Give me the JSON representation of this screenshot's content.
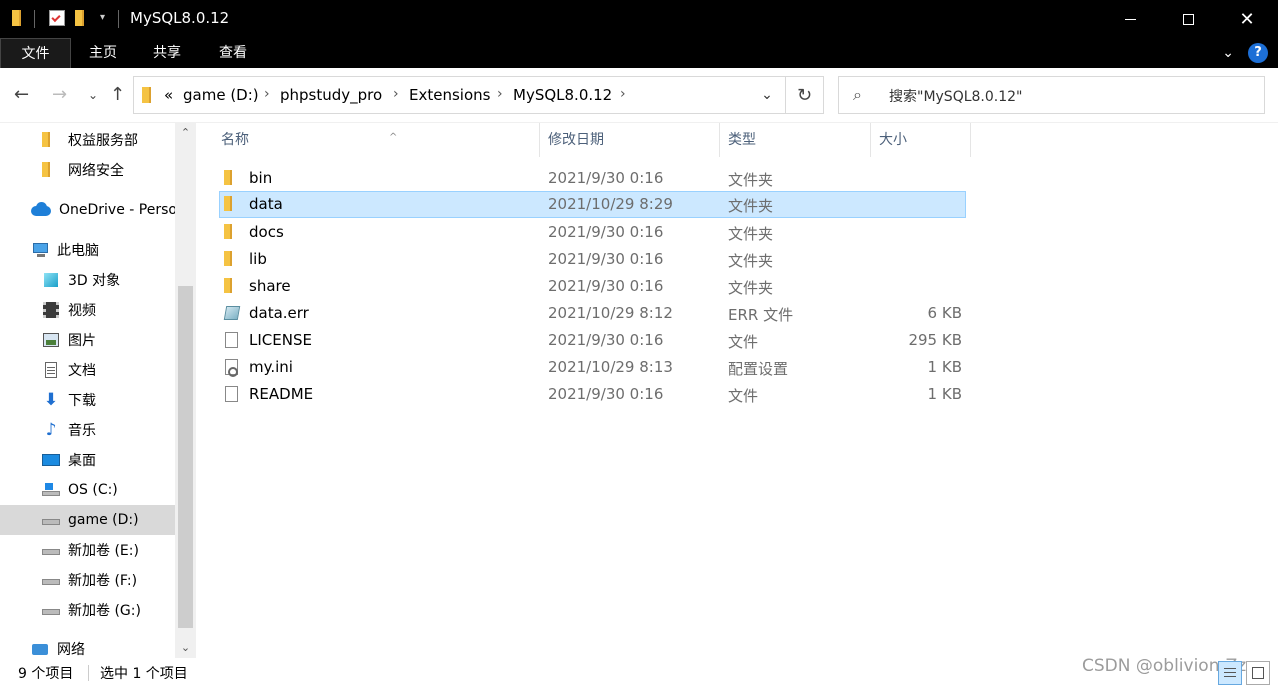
{
  "window": {
    "title": "MySQL8.0.12"
  },
  "ribbon": {
    "tabs": [
      "文件",
      "主页",
      "共享",
      "查看"
    ]
  },
  "address": {
    "overflow": "«",
    "crumbs": [
      "game (D:)",
      "phpstudy_pro",
      "Extensions",
      "MySQL8.0.12"
    ]
  },
  "search": {
    "placeholder": "搜索\"MySQL8.0.12\""
  },
  "sidebar": {
    "items": [
      {
        "label": "权益服务部",
        "icon": "folder-icon"
      },
      {
        "label": "网络安全",
        "icon": "folder-icon"
      },
      {
        "label": "OneDrive - Personal",
        "icon": "onedrive-icon"
      },
      {
        "label": "此电脑",
        "icon": "computer-icon"
      },
      {
        "label": "3D 对象",
        "icon": "3d-objects-icon"
      },
      {
        "label": "视频",
        "icon": "video-icon"
      },
      {
        "label": "图片",
        "icon": "pictures-icon"
      },
      {
        "label": "文档",
        "icon": "documents-icon"
      },
      {
        "label": "下载",
        "icon": "download-icon"
      },
      {
        "label": "音乐",
        "icon": "music-icon"
      },
      {
        "label": "桌面",
        "icon": "desktop-icon"
      },
      {
        "label": "OS (C:)",
        "icon": "windows-drive-icon"
      },
      {
        "label": "game (D:)",
        "icon": "drive-icon"
      },
      {
        "label": "新加卷 (E:)",
        "icon": "drive-icon"
      },
      {
        "label": "新加卷 (F:)",
        "icon": "drive-icon"
      },
      {
        "label": "新加卷 (G:)",
        "icon": "drive-icon"
      },
      {
        "label": "网络",
        "icon": "network-icon"
      }
    ]
  },
  "columns": {
    "name": "名称",
    "date": "修改日期",
    "type": "类型",
    "size": "大小"
  },
  "files": [
    {
      "name": "bin",
      "date": "2021/9/30 0:16",
      "type": "文件夹",
      "size": "",
      "icon": "folder-icon"
    },
    {
      "name": "data",
      "date": "2021/10/29 8:29",
      "type": "文件夹",
      "size": "",
      "icon": "folder-icon"
    },
    {
      "name": "docs",
      "date": "2021/9/30 0:16",
      "type": "文件夹",
      "size": "",
      "icon": "folder-icon"
    },
    {
      "name": "lib",
      "date": "2021/9/30 0:16",
      "type": "文件夹",
      "size": "",
      "icon": "folder-icon"
    },
    {
      "name": "share",
      "date": "2021/9/30 0:16",
      "type": "文件夹",
      "size": "",
      "icon": "folder-icon"
    },
    {
      "name": "data.err",
      "date": "2021/10/29 8:12",
      "type": "ERR 文件",
      "size": "6 KB",
      "icon": "err-file-icon"
    },
    {
      "name": "LICENSE",
      "date": "2021/9/30 0:16",
      "type": "文件",
      "size": "295 KB",
      "icon": "file-icon"
    },
    {
      "name": "my.ini",
      "date": "2021/10/29 8:13",
      "type": "配置设置",
      "size": "1 KB",
      "icon": "config-file-icon"
    },
    {
      "name": "README",
      "date": "2021/9/30 0:16",
      "type": "文件",
      "size": "1 KB",
      "icon": "file-icon"
    }
  ],
  "status": {
    "count": "9 个项目",
    "selection": "选中 1 个项目"
  },
  "watermark": "CSDN @oblivion-Zz"
}
